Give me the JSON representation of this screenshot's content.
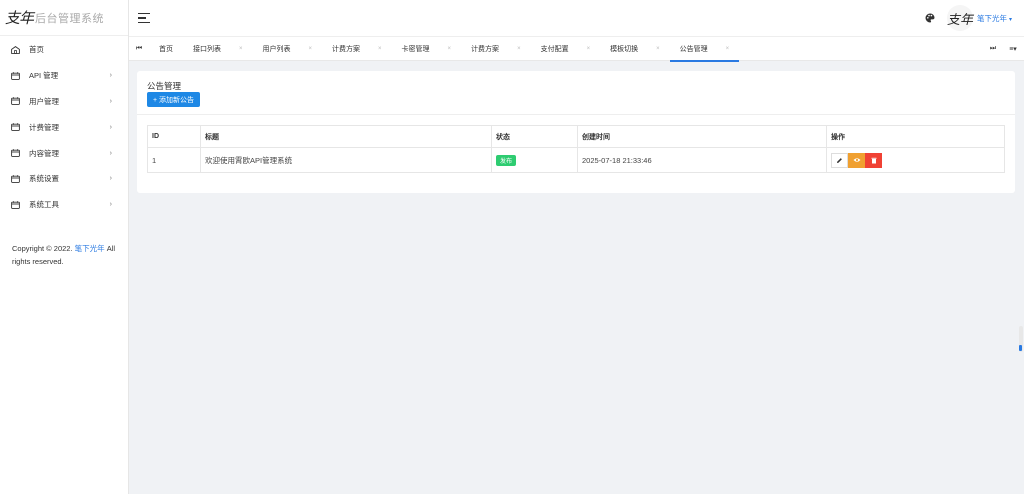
{
  "app": {
    "logo_mark": "支年",
    "title": "后台管理系统"
  },
  "sidebar": {
    "items": [
      {
        "label": "首页",
        "icon": "home-icon",
        "has_arrow": false
      },
      {
        "label": "API 管理",
        "icon": "calendar-icon",
        "has_arrow": true
      },
      {
        "label": "用户管理",
        "icon": "calendar-icon",
        "has_arrow": true
      },
      {
        "label": "计费管理",
        "icon": "calendar-icon",
        "has_arrow": true
      },
      {
        "label": "内容管理",
        "icon": "calendar-icon",
        "has_arrow": true
      },
      {
        "label": "系统设置",
        "icon": "calendar-icon",
        "has_arrow": true
      },
      {
        "label": "系统工具",
        "icon": "calendar-icon",
        "has_arrow": true
      }
    ],
    "arrow": "›",
    "copyright_prefix": "Copyright © 2022.",
    "copyright_link": "笔下光年",
    "copyright_suffix": "All rights reserved."
  },
  "header": {
    "avatar_text": "支年",
    "username": "笔下光年",
    "caret": "▾"
  },
  "tabs": {
    "prev": "⏮",
    "next": "⏭",
    "menu": "≡▾",
    "close": "×",
    "items": [
      {
        "label": "首页",
        "closable": false,
        "active": false
      },
      {
        "label": "接口列表",
        "closable": true,
        "active": false
      },
      {
        "label": "用户列表",
        "closable": true,
        "active": false
      },
      {
        "label": "计费方案",
        "closable": true,
        "active": false
      },
      {
        "label": "卡密管理",
        "closable": true,
        "active": false
      },
      {
        "label": "计费方案",
        "closable": true,
        "active": false
      },
      {
        "label": "支付配置",
        "closable": true,
        "active": false
      },
      {
        "label": "模板切换",
        "closable": true,
        "active": false
      },
      {
        "label": "公告管理",
        "closable": true,
        "active": true
      }
    ]
  },
  "page": {
    "title": "公告管理",
    "add_button": "+ 添加新公告"
  },
  "table": {
    "columns": [
      "ID",
      "标题",
      "状态",
      "创建时间",
      "操作"
    ],
    "rows": [
      {
        "id": "1",
        "title": "欢迎使用霄欧API管理系统",
        "status": "发布",
        "created": "2025-07-18 21:33:46"
      }
    ]
  },
  "colors": {
    "accent": "#1e88e5",
    "status_published": "#2ecc71",
    "view_button": "#f0a030",
    "delete_button": "#f04134"
  }
}
